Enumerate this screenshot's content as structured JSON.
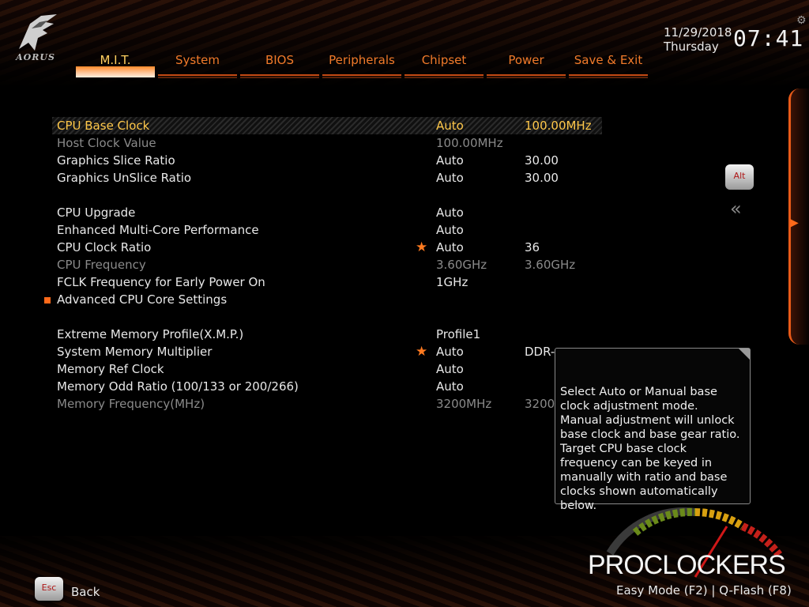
{
  "brand": "AORUS",
  "header": {
    "date": "11/29/2018",
    "day": "Thursday",
    "time": "07:41"
  },
  "tabs": [
    {
      "label": "M.I.T."
    },
    {
      "label": "System"
    },
    {
      "label": "BIOS"
    },
    {
      "label": "Peripherals"
    },
    {
      "label": "Chipset"
    },
    {
      "label": "Power"
    },
    {
      "label": "Save & Exit"
    }
  ],
  "active_tab": "M.I.T.",
  "settings": [
    {
      "label": "CPU Base Clock",
      "v1": "Auto",
      "v2": "100.00MHz"
    },
    {
      "label": "Host Clock Value",
      "v1": "100.00MHz",
      "v2": ""
    },
    {
      "label": "Graphics Slice Ratio",
      "v1": "Auto",
      "v2": "30.00"
    },
    {
      "label": "Graphics UnSlice Ratio",
      "v1": "Auto",
      "v2": "30.00"
    },
    {
      "label": "CPU Upgrade",
      "v1": "Auto",
      "v2": ""
    },
    {
      "label": "Enhanced Multi-Core Performance",
      "v1": "Auto",
      "v2": ""
    },
    {
      "label": "CPU Clock Ratio",
      "v1": "Auto",
      "v2": "36"
    },
    {
      "label": "CPU Frequency",
      "v1": "3.60GHz",
      "v2": "3.60GHz"
    },
    {
      "label": "FCLK Frequency for Early Power On",
      "v1": "1GHz",
      "v2": ""
    },
    {
      "label": "Advanced CPU Core Settings",
      "v1": "",
      "v2": ""
    },
    {
      "label": "Extreme Memory Profile(X.M.P.)",
      "v1": "Profile1",
      "v2": ""
    },
    {
      "label": "System Memory Multiplier",
      "v1": "Auto",
      "v2": "DDR-"
    },
    {
      "label": "Memory Ref Clock",
      "v1": "Auto",
      "v2": ""
    },
    {
      "label": "Memory Odd Ratio (100/133 or 200/266)",
      "v1": "Auto",
      "v2": ""
    },
    {
      "label": "Memory Frequency(MHz)",
      "v1": "3200MHz",
      "v2": "3200"
    }
  ],
  "help_text": "Select Auto or Manual base clock adjustment mode.\nManual adjustment will unlock base clock and base gear ratio.\nTarget CPU base clock frequency can be keyed in manually with ratio and base clocks shown automatically below.",
  "alt_label": "Alt",
  "esc_label": "Esc",
  "back_label": "Back",
  "hotkeys": "Easy Mode (F2)  |  Q-Flash (F8)",
  "watermark": "PROCLOCKERS",
  "icons": {
    "logo": "aorus-eagle-icon",
    "gear": "gear-icon",
    "star": "star-icon",
    "submenu": "square-bullet-icon",
    "collapse": "double-chevron-left-icon"
  },
  "colors": {
    "accent": "#f07a2a",
    "selected": "#ffc84a",
    "dim": "#8a8a8a"
  }
}
